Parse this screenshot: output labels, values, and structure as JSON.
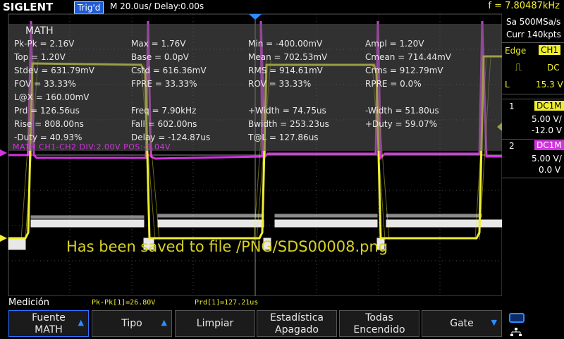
{
  "header": {
    "brand": "SIGLENT",
    "trigger_status": "Trig'd",
    "timebase": "M 20.0us/  Delay:0.00s",
    "frequency": "f = 7.80487kHz"
  },
  "right_panel": {
    "sample_rate": "Sa 500MSa/s",
    "memory": "Curr 140kpts",
    "trigger_type": "Edge",
    "trigger_source": "CH1",
    "trigger_coupling": "DC",
    "trigger_level_label": "L",
    "trigger_level": "15.3 V",
    "ch1": {
      "num": "1",
      "coupling": "DC1M",
      "scale": "5.00 V/",
      "offset": "-12.0 V",
      "color": "#f0ef2f"
    },
    "ch2": {
      "num": "2",
      "coupling": "DC1M",
      "scale": "5.00 V/",
      "offset": "0.0 V",
      "color": "#d235e0"
    }
  },
  "measurements": {
    "title": "MATH",
    "rows": [
      [
        "Pk-Pk = 2.16V",
        "Max = 1.76V",
        "Min = -400.00mV",
        "Ampl = 1.20V"
      ],
      [
        "Top = 1.20V",
        "Base = 0.0pV",
        "Mean = 702.53mV",
        "Cmean = 714.44mV"
      ],
      [
        "Stdev = 631.79mV",
        "Cstd = 616.36mV",
        "RMS = 914.61mV",
        "Crms = 912.79mV"
      ],
      [
        "FOV = 33.33%",
        "FPRE = 33.33%",
        "ROV = 33.33%",
        "RPRE = 0.0%"
      ],
      [
        "L@X = 160.00mV",
        "",
        "",
        ""
      ],
      [
        "Prd = 126.56us",
        "Freq = 7.90kHz",
        "+Width = 74.75us",
        "-Width = 51.80us"
      ],
      [
        "Rise = 808.00ns",
        "Fall = 602.00ns",
        "Bwidth = 253.23us",
        "+Duty = 59.07%"
      ],
      [
        "-Duty = 40.93%",
        "Delay = -124.87us",
        "T@L = 127.86us",
        ""
      ]
    ]
  },
  "math_label": "MATH  CH1-CH2  DIV:2.00V  POS:-5.04V",
  "saved_message": "Has been saved to file /PNG/SDS00008.png",
  "status": {
    "menu_title": "Medición",
    "stat1": "Pk-Pk[1]=26.80V",
    "stat2": "Prd[1]=127.21us"
  },
  "softkeys": [
    {
      "line1": "Fuente",
      "line2": "MATH",
      "arrow": "▲"
    },
    {
      "line1": "Tipo",
      "line2": "",
      "arrow": "▲"
    },
    {
      "line1": "Limpiar",
      "line2": "",
      "arrow": ""
    },
    {
      "line1": "Estadística",
      "line2": "Apagado",
      "arrow": ""
    },
    {
      "line1": "Todas",
      "line2": "Encendido",
      "arrow": ""
    },
    {
      "line1": "Gate",
      "line2": "",
      "arrow": "▼"
    }
  ],
  "colors": {
    "ch1": "#f0ef2f",
    "math": "#d235e0",
    "accent": "#1e5bd6",
    "ch2_trace": "#e8e8e8"
  }
}
